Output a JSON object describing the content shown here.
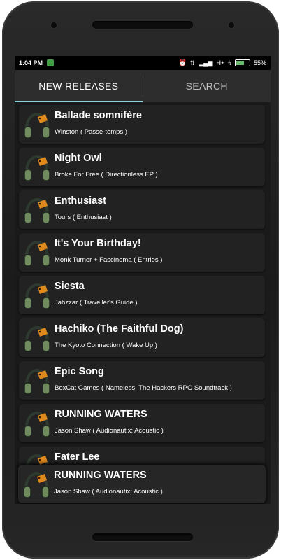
{
  "status_bar": {
    "time": "1:04 PM",
    "network": "H+",
    "battery": "55%"
  },
  "tabs": [
    {
      "label": "NEW RELEASES",
      "active": true
    },
    {
      "label": "SEARCH",
      "active": false
    }
  ],
  "tracks": [
    {
      "title": "Ballade somnifère",
      "subtitle": "Winston ( Passe-temps )"
    },
    {
      "title": "Night Owl",
      "subtitle": "Broke For Free ( Directionless EP )"
    },
    {
      "title": "Enthusiast",
      "subtitle": "Tours ( Enthusiast )"
    },
    {
      "title": "It's Your Birthday!",
      "subtitle": "Monk Turner + Fascinoma ( Entries )"
    },
    {
      "title": "Siesta",
      "subtitle": "Jahzzar ( Traveller's Guide )"
    },
    {
      "title": "Hachiko (The Faithful Dog)",
      "subtitle": "The Kyoto Connection ( Wake Up )"
    },
    {
      "title": "Epic Song",
      "subtitle": "BoxCat Games ( Nameless: The Hackers RPG Soundtrack )"
    },
    {
      "title": "RUNNING WATERS",
      "subtitle": "Jason Shaw ( Audionautix: Acoustic )"
    },
    {
      "title": "Fater Lee",
      "subtitle": ""
    }
  ],
  "now_playing": {
    "title": "RUNNING WATERS",
    "subtitle": "Jason Shaw ( Audionautix: Acoustic )"
  },
  "colors": {
    "tab_indicator": "#8fd3d8",
    "headphone_band": "#2e3a2f",
    "headphone_cup": "#6f8a5c",
    "mp3_tag": "#e08a1e"
  }
}
